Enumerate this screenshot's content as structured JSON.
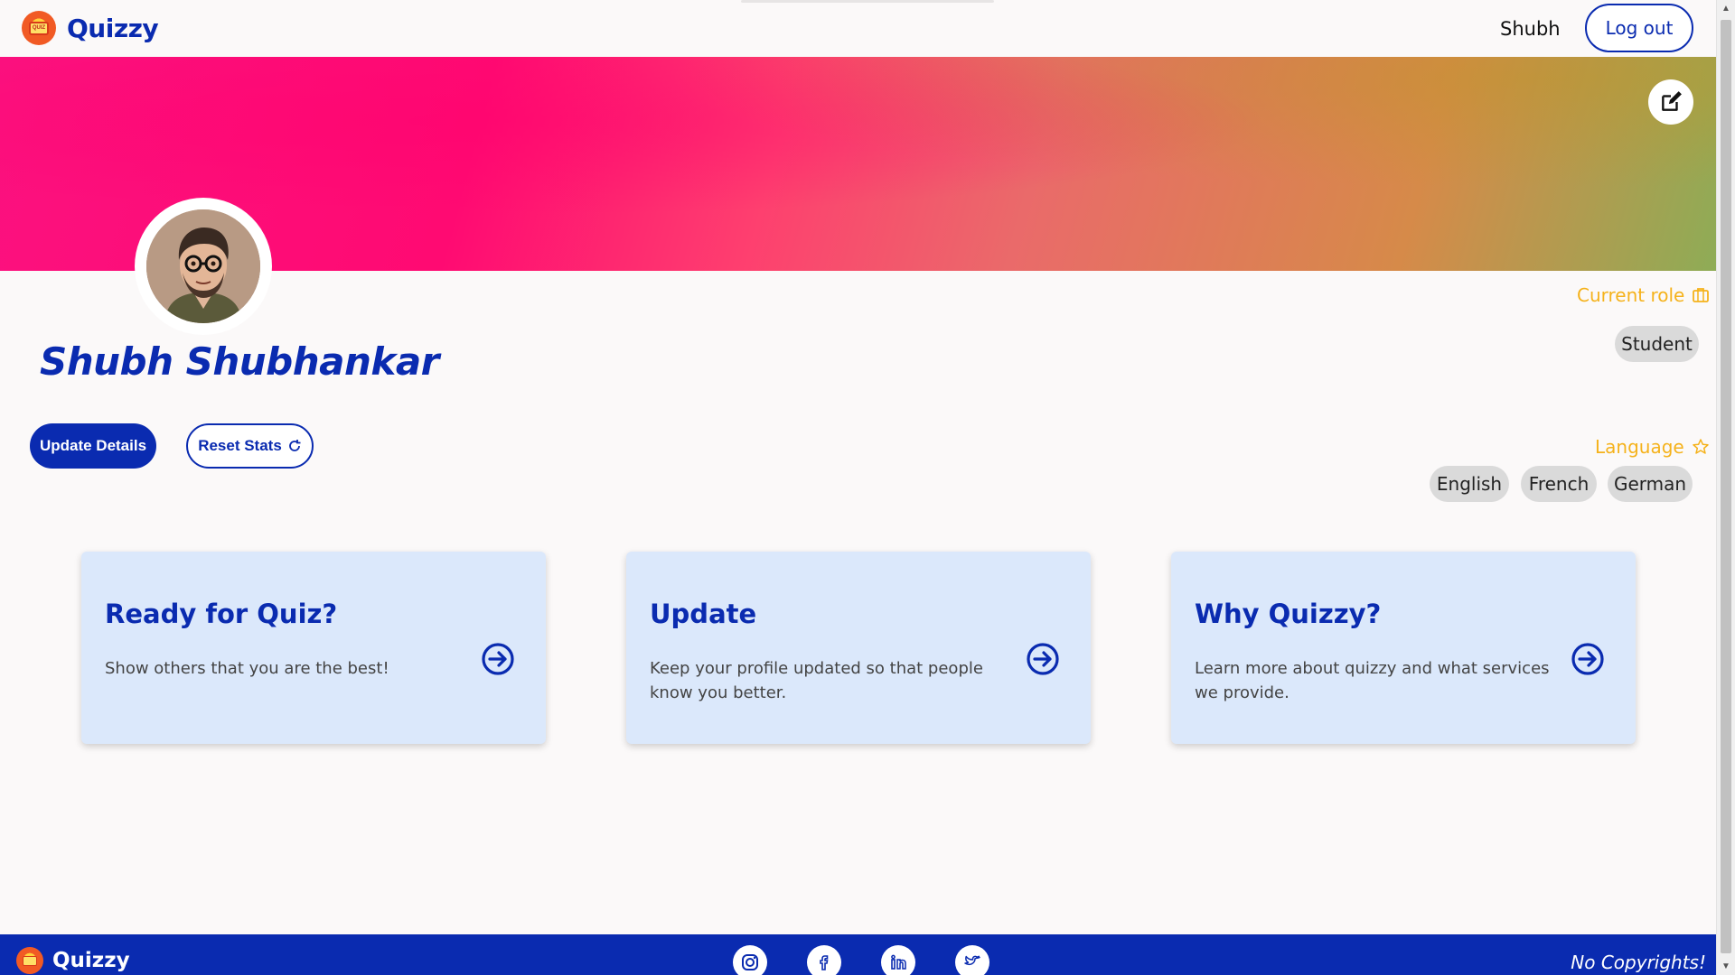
{
  "navbar": {
    "brand": "Quizzy",
    "logo_text": "QUIZ",
    "username": "Shubh",
    "logout_label": "Log out"
  },
  "profile": {
    "name": "Shubh Shubhankar",
    "update_label": "Update Details",
    "reset_label": "Reset Stats"
  },
  "role": {
    "label": "Current role",
    "value": "Student"
  },
  "language": {
    "label": "Language",
    "items": [
      "English",
      "French",
      "German"
    ]
  },
  "cards": [
    {
      "title": "Ready for Quiz?",
      "text": "Show others that you are the best!"
    },
    {
      "title": "Update",
      "text": "Keep your profile updated so that people know you better."
    },
    {
      "title": "Why Quizzy?",
      "text": "Learn more about quizzy and what services we provide."
    }
  ],
  "footer": {
    "brand": "Quizzy",
    "copyright": "No Copyrights!",
    "social": [
      "instagram-icon",
      "facebook-icon",
      "linkedin-icon",
      "twitter-icon"
    ]
  },
  "colors": {
    "primary": "#0a2bb0",
    "accent": "#f5b21b",
    "card_bg": "#dbe8fb"
  }
}
